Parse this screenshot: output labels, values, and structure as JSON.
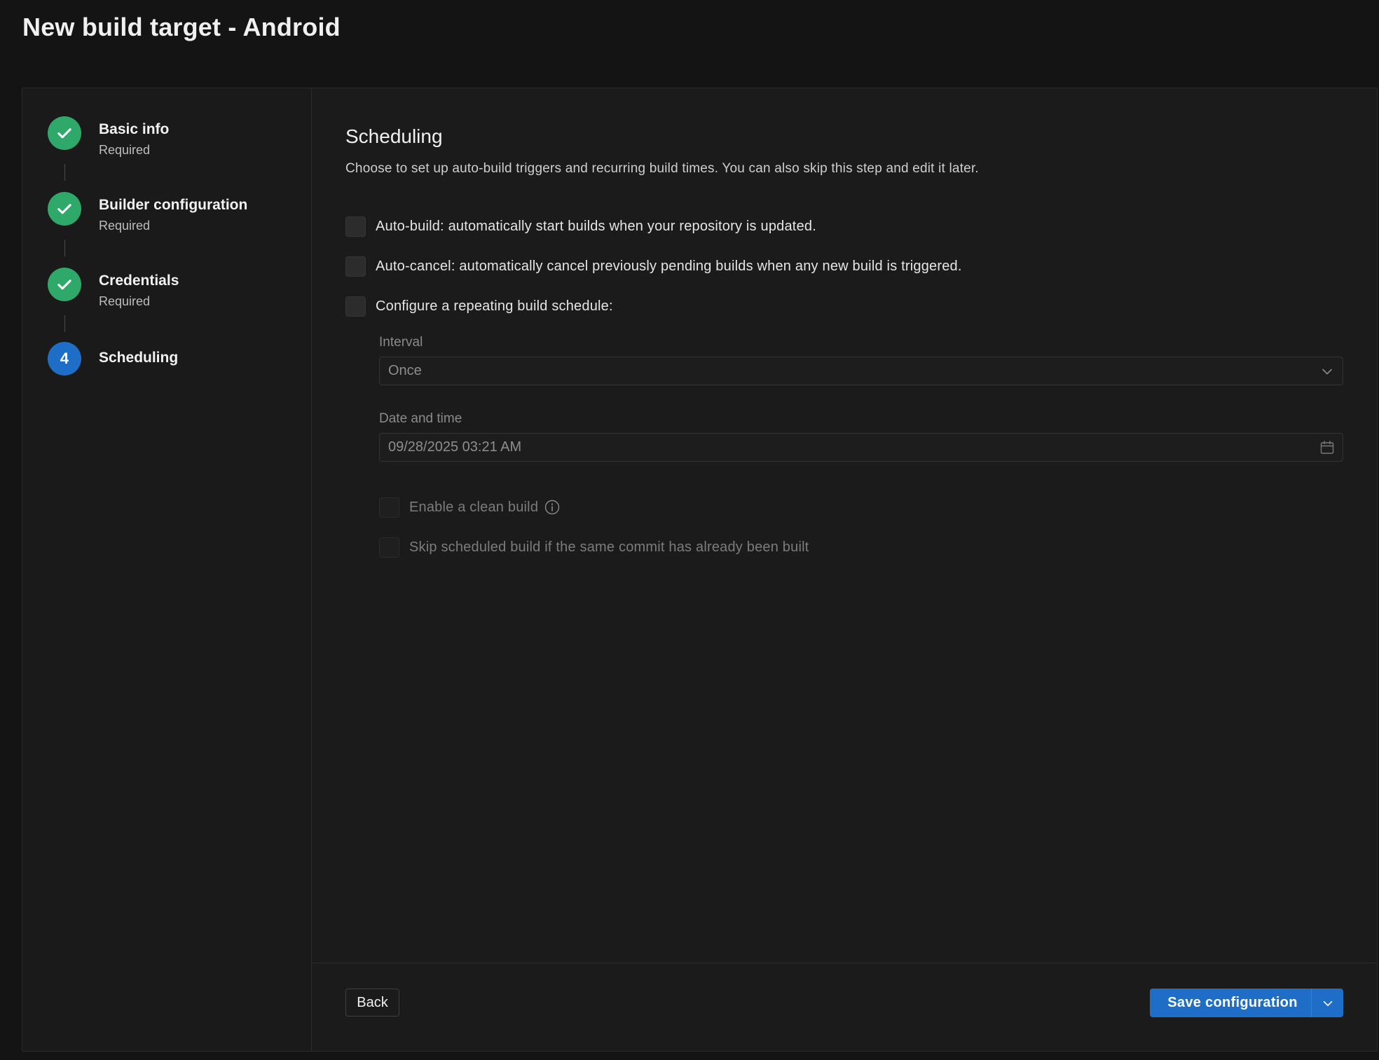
{
  "page": {
    "title": "New build target - Android"
  },
  "steps": [
    {
      "title": "Basic info",
      "subtitle": "Required",
      "state": "done"
    },
    {
      "title": "Builder configuration",
      "subtitle": "Required",
      "state": "done"
    },
    {
      "title": "Credentials",
      "subtitle": "Required",
      "state": "done"
    },
    {
      "title": "Scheduling",
      "subtitle": "",
      "state": "current",
      "number": "4"
    }
  ],
  "scheduling": {
    "title": "Scheduling",
    "description": "Choose to set up auto-build triggers and recurring build times. You can also skip this step and edit it later.",
    "options": [
      {
        "label": "Auto-build: automatically start builds when your repository is updated.",
        "checked": false
      },
      {
        "label": "Auto-cancel: automatically cancel previously pending builds when any new build is triggered.",
        "checked": false
      },
      {
        "label": "Configure a repeating build schedule:",
        "checked": false
      }
    ],
    "interval": {
      "label": "Interval",
      "value": "Once"
    },
    "datetime": {
      "label": "Date and time",
      "value": "09/28/2025 03:21 AM"
    },
    "sub_options": [
      {
        "label": "Enable a clean build",
        "checked": false,
        "disabled": true,
        "icon": "info-icon"
      },
      {
        "label": "Skip scheduled build if the same commit has already been built",
        "checked": false,
        "disabled": true
      }
    ]
  },
  "footer": {
    "back_label": "Back",
    "save_label": "Save configuration"
  },
  "colors": {
    "accent": "#1e6ec8",
    "success": "#2fa96a",
    "background": "#141414"
  }
}
